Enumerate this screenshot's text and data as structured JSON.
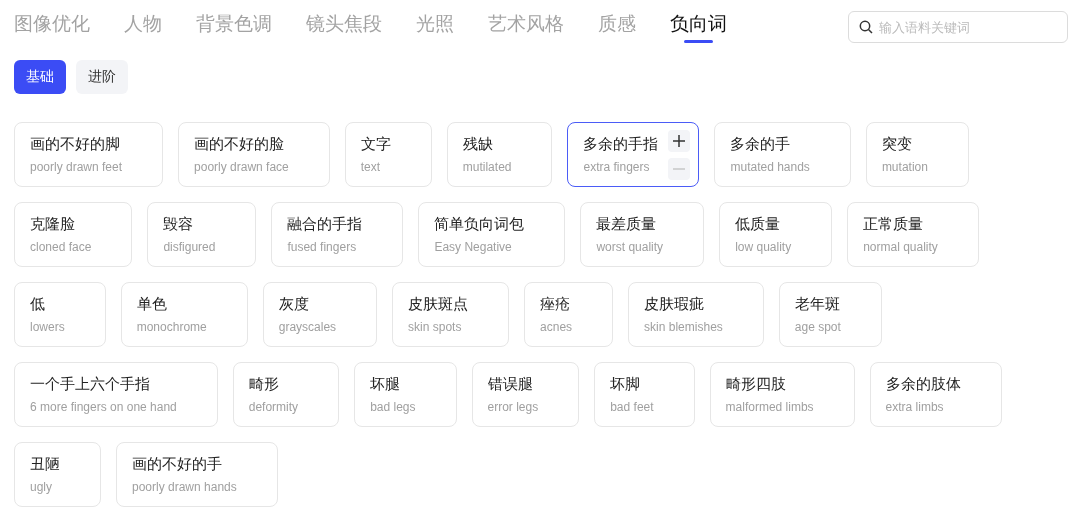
{
  "tabs": [
    {
      "label": "图像优化",
      "selected": false
    },
    {
      "label": "人物",
      "selected": false
    },
    {
      "label": "背景色调",
      "selected": false
    },
    {
      "label": "镜头焦段",
      "selected": false
    },
    {
      "label": "光照",
      "selected": false
    },
    {
      "label": "艺术风格",
      "selected": false
    },
    {
      "label": "质感",
      "selected": false
    },
    {
      "label": "负向词",
      "selected": true
    }
  ],
  "search": {
    "placeholder": "输入语料关键词"
  },
  "subtabs": [
    {
      "label": "基础",
      "selected": true
    },
    {
      "label": "进阶",
      "selected": false
    }
  ],
  "card_rows": [
    [
      {
        "zh": "画的不好的脚",
        "en": "poorly drawn feet",
        "hovered": false
      },
      {
        "zh": "画的不好的脸",
        "en": "poorly drawn face",
        "hovered": false
      },
      {
        "zh": "文字",
        "en": "text",
        "hovered": false
      },
      {
        "zh": "残缺",
        "en": "mutilated",
        "hovered": false
      },
      {
        "zh": "多余的手指",
        "en": "extra fingers",
        "hovered": true
      },
      {
        "zh": "多余的手",
        "en": "mutated hands",
        "hovered": false
      },
      {
        "zh": "突变",
        "en": "mutation",
        "hovered": false
      }
    ],
    [
      {
        "zh": "克隆脸",
        "en": "cloned face",
        "hovered": false
      },
      {
        "zh": "毁容",
        "en": "disfigured",
        "hovered": false
      },
      {
        "zh": "融合的手指",
        "en": "fused fingers",
        "hovered": false
      },
      {
        "zh": "简单负向词包",
        "en": "Easy Negative",
        "hovered": false
      },
      {
        "zh": "最差质量",
        "en": "worst quality",
        "hovered": false
      },
      {
        "zh": "低质量",
        "en": "low quality",
        "hovered": false
      },
      {
        "zh": "正常质量",
        "en": "normal quality",
        "hovered": false
      }
    ],
    [
      {
        "zh": "低",
        "en": "lowers",
        "hovered": false
      },
      {
        "zh": "单色",
        "en": "monochrome",
        "hovered": false
      },
      {
        "zh": "灰度",
        "en": "grayscales",
        "hovered": false
      },
      {
        "zh": "皮肤斑点",
        "en": "skin spots",
        "hovered": false
      },
      {
        "zh": "痤疮",
        "en": "acnes",
        "hovered": false
      },
      {
        "zh": "皮肤瑕疵",
        "en": "skin blemishes",
        "hovered": false
      },
      {
        "zh": "老年斑",
        "en": "age spot",
        "hovered": false
      }
    ],
    [
      {
        "zh": "一个手上六个手指",
        "en": "6 more fingers on one hand",
        "hovered": false
      },
      {
        "zh": "畸形",
        "en": "deformity",
        "hovered": false
      },
      {
        "zh": "坏腿",
        "en": "bad legs",
        "hovered": false
      },
      {
        "zh": "错误腿",
        "en": "error legs",
        "hovered": false
      },
      {
        "zh": "坏脚",
        "en": "bad feet",
        "hovered": false
      },
      {
        "zh": "畸形四肢",
        "en": "malformed limbs",
        "hovered": false
      },
      {
        "zh": "多余的肢体",
        "en": "extra limbs",
        "hovered": false
      }
    ],
    [
      {
        "zh": "丑陋",
        "en": "ugly",
        "hovered": false
      },
      {
        "zh": "画的不好的手",
        "en": "poorly drawn hands",
        "hovered": false
      }
    ]
  ]
}
